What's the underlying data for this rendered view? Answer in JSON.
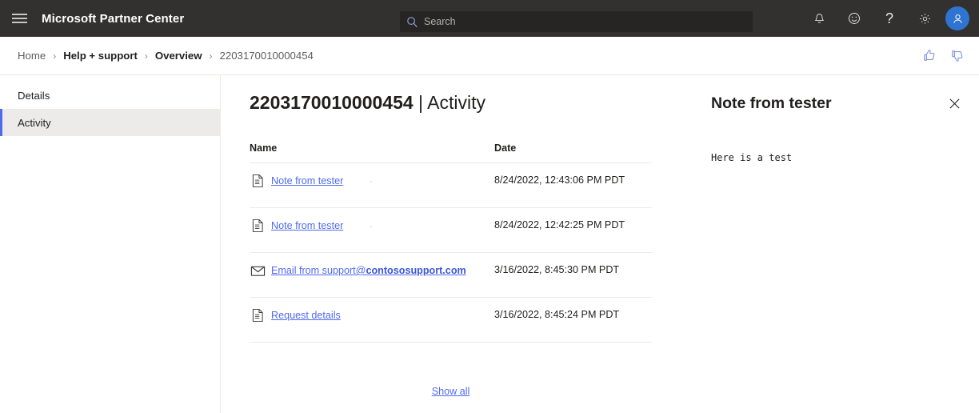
{
  "topbar": {
    "menu_icon": "hamburger-icon",
    "brand": "Microsoft Partner Center",
    "search": {
      "icon": "search-icon",
      "value": "",
      "placeholder": "Search"
    },
    "actions": [
      {
        "name": "notifications-icon",
        "label": "Notifications"
      },
      {
        "name": "feedback-smiley-icon",
        "label": "Feedback"
      },
      {
        "name": "help-question-icon",
        "label": "Help"
      },
      {
        "name": "settings-gear-icon",
        "label": "Settings"
      }
    ],
    "avatar": {
      "name": "avatar",
      "label": "Account"
    },
    "colors": {
      "bar": "#323130",
      "search_bg": "#262523",
      "avatar_bg": "#2e74d0"
    }
  },
  "breadcrumb": {
    "items": [
      {
        "label": "Home",
        "style": "muted"
      },
      {
        "label": "Help + support",
        "style": "strong"
      },
      {
        "label": "Overview",
        "style": "strong"
      },
      {
        "label": "2203170010000454",
        "style": "tail"
      }
    ],
    "separator": "›",
    "feedback": [
      {
        "name": "thumbs-up-icon",
        "label": "Like"
      },
      {
        "name": "thumbs-down-icon",
        "label": "Dislike"
      }
    ]
  },
  "sidebar": {
    "items": [
      {
        "label": "Details",
        "selected": false
      },
      {
        "label": "Activity",
        "selected": true
      }
    ],
    "accent_color": "#4f6bed",
    "selected_bg": "#edebe9"
  },
  "main": {
    "title_id": "2203170010000454",
    "title_suffix": " | Activity",
    "table": {
      "columns": {
        "name": "Name",
        "date": "Date"
      },
      "rows": [
        {
          "icon": "document-icon",
          "name": "Note from tester",
          "name_domain": "",
          "trailing_dot": ".",
          "date": "8/24/2022, 12:43:06 PM PDT"
        },
        {
          "icon": "document-icon",
          "name": "Note from tester",
          "name_domain": "",
          "trailing_dot": ".",
          "date": "8/24/2022, 12:42:25 PM PDT"
        },
        {
          "icon": "envelope-icon",
          "name": "Email from support@",
          "name_domain": "contososupport.com",
          "trailing_dot": "",
          "date": "3/16/2022, 8:45:30 PM PDT"
        },
        {
          "icon": "document-icon",
          "name": "Request details",
          "name_domain": "",
          "trailing_dot": "",
          "date": "3/16/2022, 8:45:24 PM PDT"
        }
      ]
    },
    "show_all": "Show all",
    "link_color": "#4f6bed"
  },
  "panel": {
    "title": "Note from tester",
    "body": "Here is a test",
    "close_icon": "close-icon"
  }
}
